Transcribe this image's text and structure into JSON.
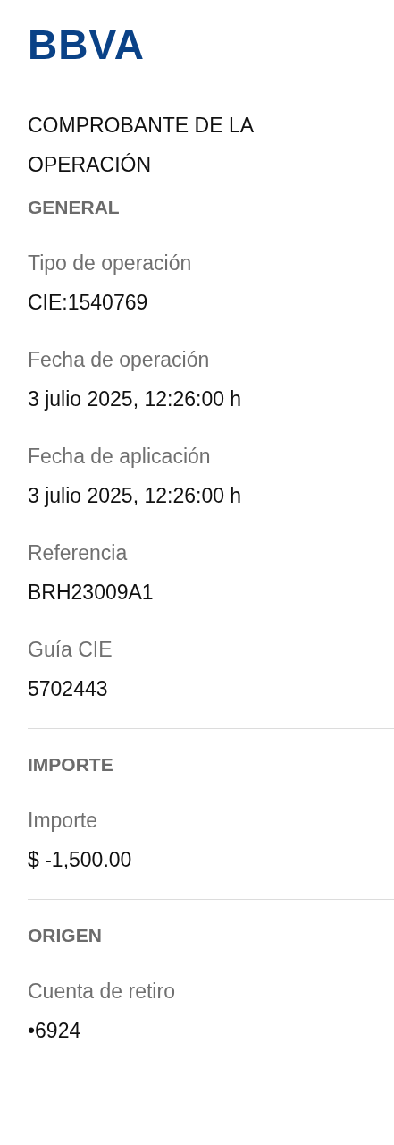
{
  "logo": "BBVA",
  "title": "COMPROBANTE DE LA OPERACIÓN",
  "sections": [
    {
      "heading": "GENERAL",
      "fields": [
        {
          "label": "Tipo de operación",
          "value": "CIE:1540769"
        },
        {
          "label": "Fecha de operación",
          "value": "3 julio 2025, 12:26:00 h"
        },
        {
          "label": "Fecha de aplicación",
          "value": "3 julio 2025, 12:26:00 h"
        },
        {
          "label": "Referencia",
          "value": "BRH23009A1"
        },
        {
          "label": "Guía CIE",
          "value": "5702443"
        }
      ]
    },
    {
      "heading": "IMPORTE",
      "fields": [
        {
          "label": "Importe",
          "value": "$ -1,500.00"
        }
      ]
    },
    {
      "heading": "ORIGEN",
      "fields": [
        {
          "label": "Cuenta de retiro",
          "value": "•6924"
        }
      ]
    }
  ]
}
